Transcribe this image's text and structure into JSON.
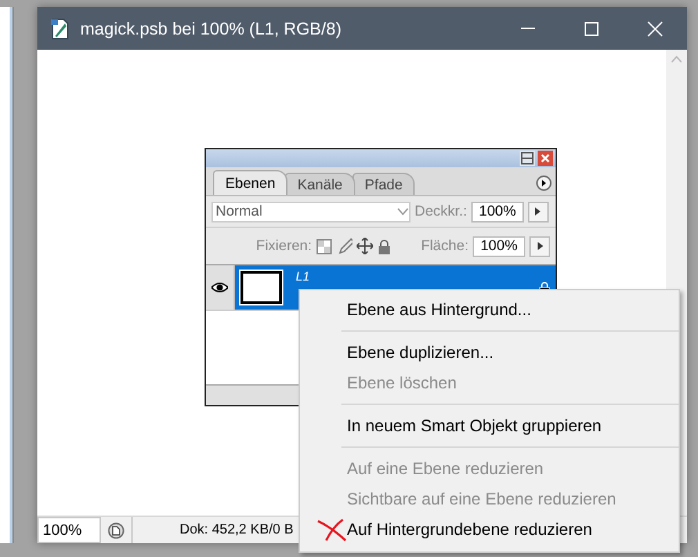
{
  "window": {
    "title": "magick.psb bei 100% (L1, RGB/8)"
  },
  "layers_panel": {
    "tabs": [
      {
        "label": "Ebenen",
        "selected": true
      },
      {
        "label": "Kanäle",
        "selected": false
      },
      {
        "label": "Pfade",
        "selected": false
      }
    ],
    "blend_mode": {
      "value": "Normal"
    },
    "opacity": {
      "label": "Deckkr.:",
      "value": "100%"
    },
    "lock_label": "Fixieren:",
    "fill": {
      "label": "Fläche:",
      "value": "100%"
    },
    "layers": [
      {
        "name": "L1",
        "visible": true,
        "selected": true,
        "locked": true
      }
    ]
  },
  "context_menu": {
    "items": [
      {
        "kind": "item",
        "label": "Ebene aus Hintergrund...",
        "disabled": false,
        "crossed": false
      },
      {
        "kind": "separator"
      },
      {
        "kind": "item",
        "label": "Ebene duplizieren...",
        "disabled": false,
        "crossed": false
      },
      {
        "kind": "item",
        "label": "Ebene löschen",
        "disabled": true,
        "crossed": false
      },
      {
        "kind": "separator"
      },
      {
        "kind": "item",
        "label": "In neuem Smart Objekt gruppieren",
        "disabled": false,
        "crossed": false
      },
      {
        "kind": "separator"
      },
      {
        "kind": "item",
        "label": "Auf eine Ebene reduzieren",
        "disabled": true,
        "crossed": false
      },
      {
        "kind": "item",
        "label": "Sichtbare auf eine Ebene reduzieren",
        "disabled": true,
        "crossed": false
      },
      {
        "kind": "item",
        "label": "Auf Hintergrundebene reduzieren",
        "disabled": false,
        "crossed": true
      }
    ]
  },
  "status_bar": {
    "zoom": "100%",
    "doc_info": "Dok: 452,2 KB/0 B"
  }
}
